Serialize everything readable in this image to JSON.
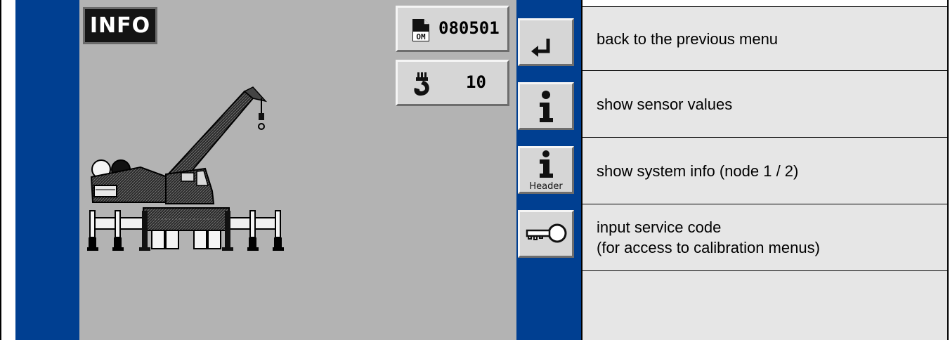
{
  "screen": {
    "mode_label": "INFO",
    "order_number": "080501",
    "order_icon": "document-om-icon",
    "hook_value": "10",
    "hook_icon": "crane-hook-icon",
    "crane_image": "crane-outrigger-illustration"
  },
  "side_buttons": [
    {
      "icon": "return-arrow-icon",
      "label": ""
    },
    {
      "icon": "info-icon",
      "label": ""
    },
    {
      "icon": "info-header-icon",
      "label": "Header"
    },
    {
      "icon": "key-icon",
      "label": ""
    }
  ],
  "descriptions": [
    "back to the previous menu",
    "show sensor values",
    "show system info (node 1 / 2)",
    "input service code\n(for access to calibration menus)",
    ""
  ],
  "colors": {
    "panel_blue": "#003f91",
    "display_gray": "#b3b3b3",
    "button_gray": "#d6d6d6",
    "table_gray": "#e6e6e6"
  }
}
